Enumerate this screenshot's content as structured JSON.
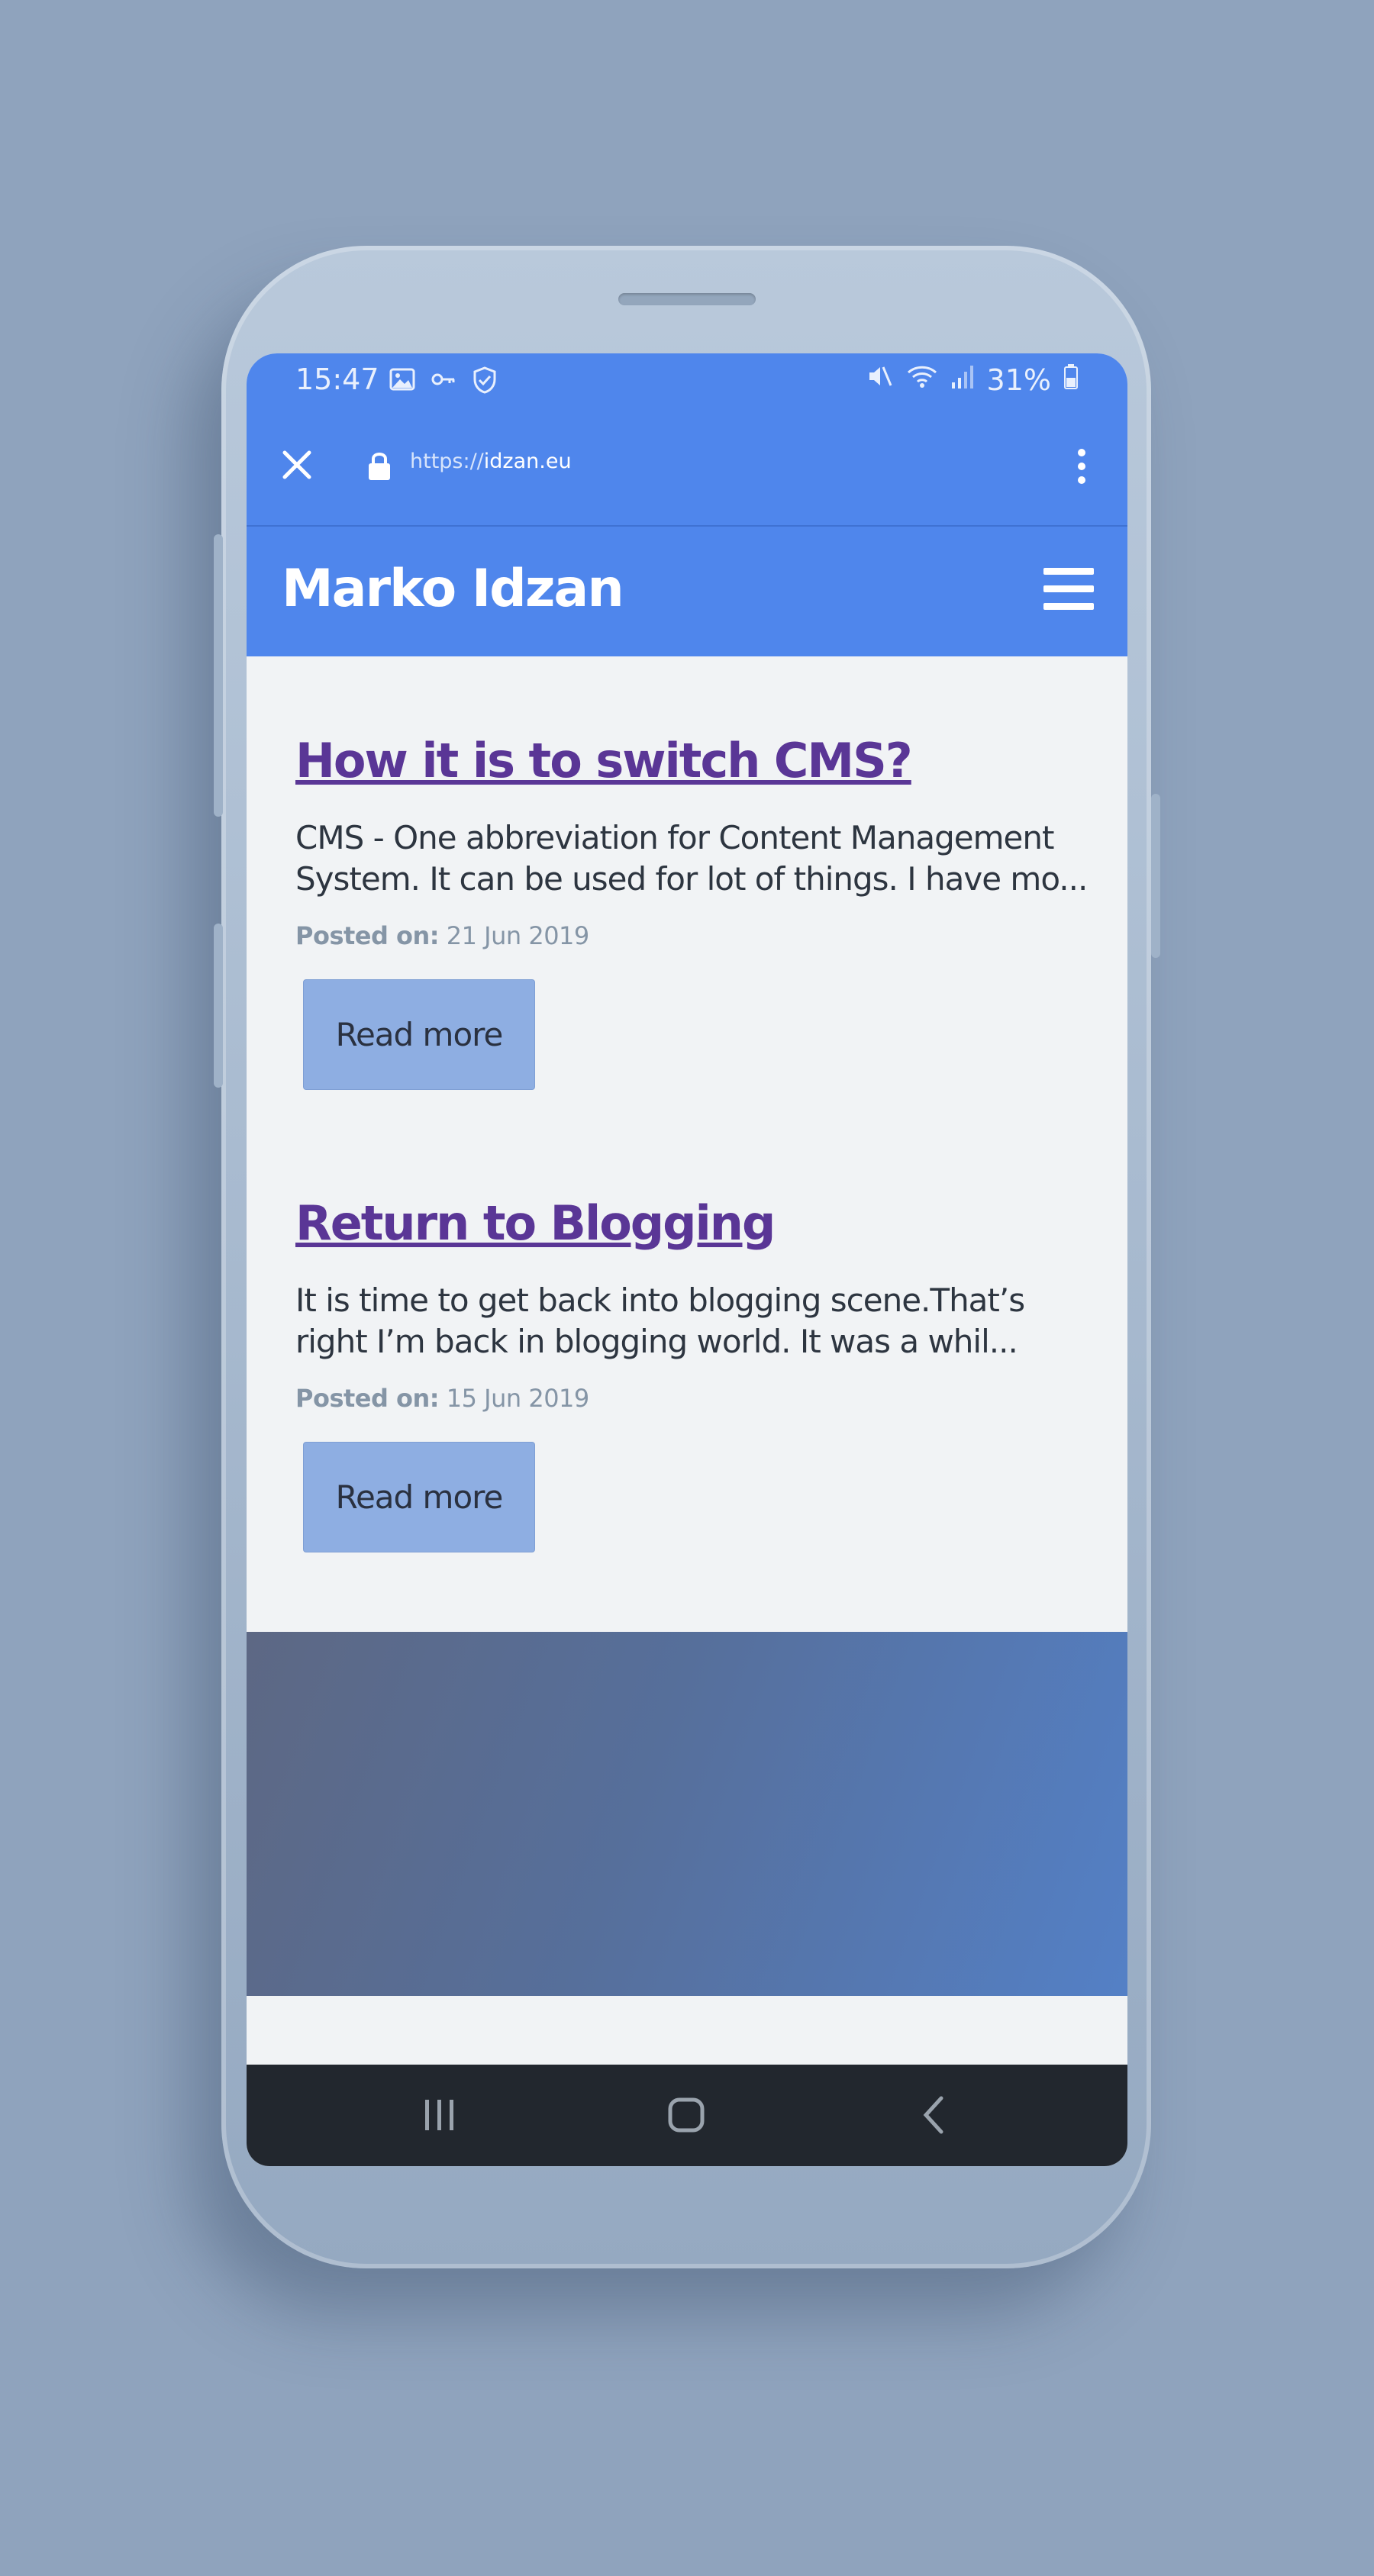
{
  "status_bar": {
    "time": "15:47",
    "battery": "31%"
  },
  "address_bar": {
    "url_scheme": "https://",
    "url_host": "idzan.eu"
  },
  "site": {
    "title": "Marko Idzan"
  },
  "posts": [
    {
      "title": "How it is to switch CMS?",
      "excerpt": "CMS - One abbreviation for Content Management System. It can be used for lot of things. I have mo...",
      "posted_label": "Posted on:",
      "date": "21 Jun 2019",
      "read_more": "Read more"
    },
    {
      "title": "Return to Blogging",
      "excerpt": "It is time to get back into blogging scene.That’s right I’m back in blogging world. It was a whil...",
      "posted_label": "Posted on:",
      "date": "15 Jun 2019",
      "read_more": "Read more"
    }
  ],
  "colors": {
    "accent": "#4f86ec",
    "link": "#5a3696",
    "button": "#8eaee2",
    "background": "#8fa3bd"
  },
  "icons": [
    "image-icon",
    "key-icon",
    "shield-icon",
    "mute-icon",
    "wifi-icon",
    "signal-icon",
    "battery-icon",
    "close-icon",
    "lock-icon",
    "kebab-menu-icon",
    "hamburger-menu-icon",
    "recents-icon",
    "home-icon",
    "back-icon"
  ]
}
